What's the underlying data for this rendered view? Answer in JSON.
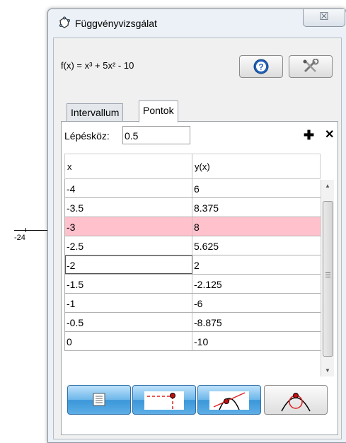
{
  "background": {
    "axis_label": "-24"
  },
  "window": {
    "title": "Függvényvizsgálat",
    "close_glyph": "☒",
    "function_label": "f(x) = x³ + 5x² - 10",
    "help_icon": "help-icon",
    "tools_icon": "tools-icon",
    "tabs": [
      {
        "label": "Intervallum",
        "active": false
      },
      {
        "label": "Pontok",
        "active": true
      }
    ],
    "step": {
      "label": "Lépésköz:",
      "value": "0.5"
    },
    "add_glyph": "✚",
    "remove_glyph": "✕",
    "table": {
      "headers": [
        "x",
        "y(x)"
      ],
      "rows": [
        {
          "x": "-4",
          "y": "6"
        },
        {
          "x": "-3.5",
          "y": "8.375"
        },
        {
          "x": "-3",
          "y": "8"
        },
        {
          "x": "-2.5",
          "y": "5.625"
        },
        {
          "x": "-2",
          "y": "2"
        },
        {
          "x": "-1.5",
          "y": "-2.125"
        },
        {
          "x": "-1",
          "y": "-6"
        },
        {
          "x": "-0.5",
          "y": "-8.875"
        },
        {
          "x": "0",
          "y": "-10"
        }
      ],
      "selected_row": 2,
      "focused_row": 4
    },
    "mode_buttons": [
      {
        "icon": "table-icon",
        "active": true
      },
      {
        "icon": "point-trace-icon",
        "active": true
      },
      {
        "icon": "tangent-icon",
        "active": true
      },
      {
        "icon": "osculating-circle-icon",
        "active": false
      }
    ]
  },
  "colors": {
    "selected_row": "#ffc1cc",
    "active_button": "#3a96d8",
    "trace_red": "#e02020"
  }
}
